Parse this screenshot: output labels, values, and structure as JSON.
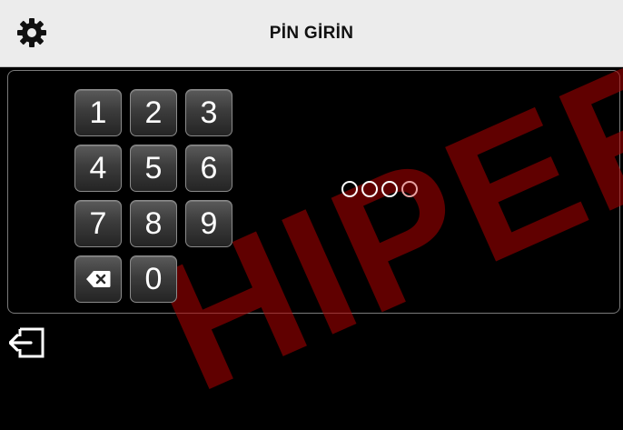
{
  "header": {
    "title": "PİN GİRİN",
    "settings_icon": "gear-icon"
  },
  "keypad": {
    "keys": [
      "1",
      "2",
      "3",
      "4",
      "5",
      "6",
      "7",
      "8",
      "9",
      "0"
    ],
    "backspace_icon": "backspace-icon"
  },
  "pin": {
    "length": 4,
    "entered": 0
  },
  "footer": {
    "exit_icon": "exit-icon"
  },
  "watermark": {
    "text": "HIPER"
  },
  "colors": {
    "watermark": "#b00000",
    "header_bg": "#ececec"
  }
}
